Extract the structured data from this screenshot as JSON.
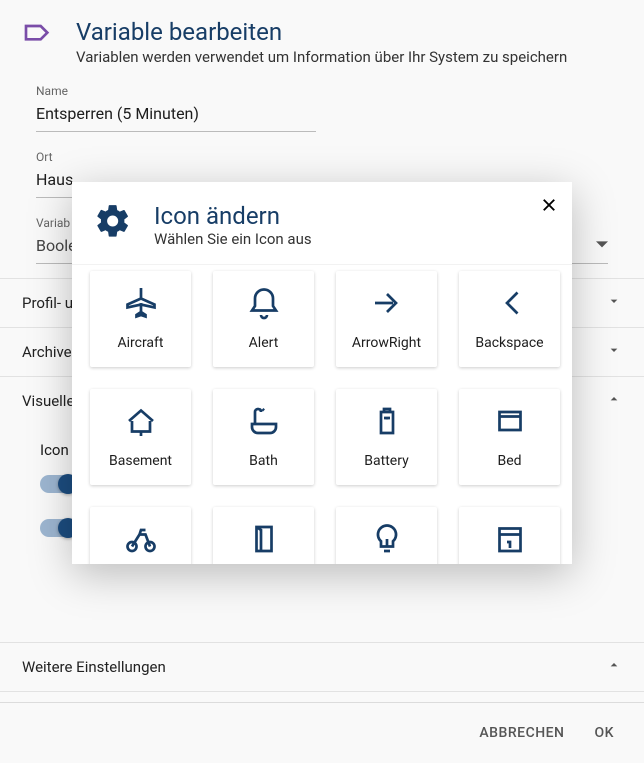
{
  "header": {
    "title": "Variable bearbeiten",
    "subtitle": "Variablen werden verwendet um Information über Ihr System zu speichern"
  },
  "fields": {
    "name_label": "Name",
    "name_value": "Entsperren (5 Minuten)",
    "ort_label": "Ort",
    "ort_value": "Haus",
    "type_label": "Variab",
    "type_value": "Boole"
  },
  "sections": {
    "profil": "Profil- u",
    "archive": "Archive",
    "visuelle": "Visuelle",
    "weitere": "Weitere Einstellungen"
  },
  "icon_setting_label": "Icon",
  "footer": {
    "cancel": "ABBRECHEN",
    "ok": "OK"
  },
  "modal": {
    "title": "Icon ändern",
    "subtitle": "Wählen Sie ein Icon aus",
    "icons": [
      {
        "name": "Aircraft"
      },
      {
        "name": "Alert"
      },
      {
        "name": "ArrowRight"
      },
      {
        "name": "Backspace"
      },
      {
        "name": "Basement"
      },
      {
        "name": "Bath"
      },
      {
        "name": "Battery"
      },
      {
        "name": "Bed"
      },
      {
        "name": "Bike"
      },
      {
        "name": "Book"
      },
      {
        "name": "Bulb"
      },
      {
        "name": "Calendar"
      }
    ]
  },
  "colors": {
    "primary": "#173d66"
  }
}
